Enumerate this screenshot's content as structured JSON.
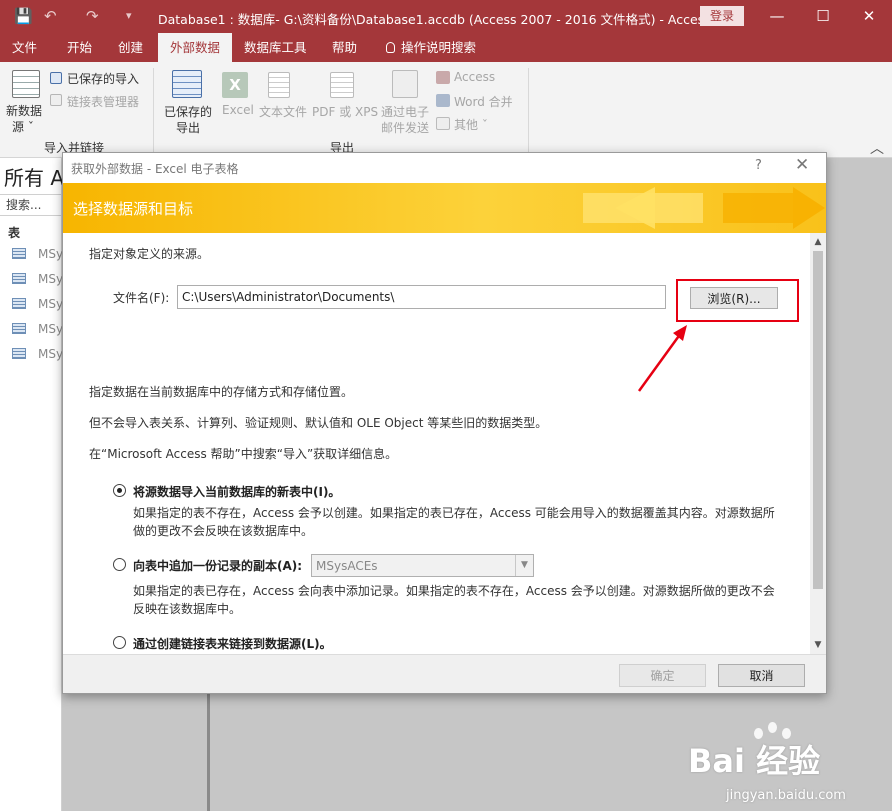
{
  "window": {
    "title": "Database1 : 数据库- G:\\资料备份\\Database1.accdb (Access 2007 - 2016 文件格式)  -  Access",
    "login_label": "登录",
    "minimize_glyph": "—",
    "restore_glyph": "☐",
    "close_glyph": "✕",
    "quick_access": [
      "💾",
      "↶",
      "↷",
      "▾"
    ]
  },
  "ribbon_tabs": [
    {
      "label": "文件",
      "active": false
    },
    {
      "label": "开始",
      "active": false
    },
    {
      "label": "创建",
      "active": false
    },
    {
      "label": "外部数据",
      "active": true
    },
    {
      "label": "数据库工具",
      "active": false
    },
    {
      "label": "帮助",
      "active": false
    },
    {
      "label": "操作说明搜索",
      "active": false
    }
  ],
  "ribbon": {
    "import_group": {
      "new_source_line1": "新数据",
      "new_source_line2": "源 ˇ",
      "saved_imports": "已保存的导入",
      "linked_table_manager": "链接表管理器",
      "group_label": "导入并链接"
    },
    "export_group": {
      "saved_exports_line1": "已保存的",
      "saved_exports_line2": "导出",
      "excel": "Excel",
      "text_file": "文本文件",
      "pdf_xps": "PDF 或 XPS",
      "email_line1": "通过电子",
      "email_line2": "邮件发送",
      "access": "Access",
      "word_merge": "Word 合并",
      "more": "其他 ˇ",
      "group_label": "导出"
    },
    "collapse_glyph": "︿"
  },
  "nav_pane": {
    "title": "所有 A",
    "search_placeholder": "搜索...",
    "section_label": "表",
    "items": [
      "MSysACEs",
      "MSysObjects",
      "MSysQueries",
      "MSysRelationships",
      "MSysResources"
    ]
  },
  "dialog": {
    "title": "获取外部数据 - Excel 电子表格",
    "help_glyph": "?",
    "close_glyph": "✕",
    "banner_title": "选择数据源和目标",
    "source_prompt": "指定对象定义的来源。",
    "file_label": "文件名(F):",
    "file_value": "C:\\Users\\Administrator\\Documents\\",
    "browse_label": "浏览(R)...",
    "storage_prompt": "指定数据在当前数据库中的存储方式和存储位置。",
    "note_unsupported": "但不会导入表关系、计算列、验证规则、默认值和 OLE Object 等某些旧的数据类型。",
    "note_help": "在“Microsoft Access 帮助”中搜索“导入”获取详细信息。",
    "options": [
      {
        "label": "将源数据导入当前数据库的新表中(I)。",
        "selected": true,
        "description": "如果指定的表不存在，Access 会予以创建。如果指定的表已存在，Access 可能会用导入的数据覆盖其内容。对源数据所做的更改不会反映在该数据库中。"
      },
      {
        "label": "向表中追加一份记录的副本(A):",
        "selected": false,
        "description": "如果指定的表已存在，Access 会向表中添加记录。如果指定的表不存在，Access 会予以创建。对源数据所做的更改不会反映在该数据库中。"
      },
      {
        "label": "通过创建链接表来链接到数据源(L)。",
        "selected": false,
        "description": ""
      }
    ],
    "append_table_value": "MSysACEs",
    "ok_label": "确定",
    "cancel_label": "取消"
  },
  "watermark": {
    "text": "Bai  经验",
    "sub": "jingyan.baidu.com"
  },
  "colors": {
    "access_red": "#a4373a",
    "banner_yellow": "#f9bf0c",
    "highlight_red": "#e60012"
  }
}
